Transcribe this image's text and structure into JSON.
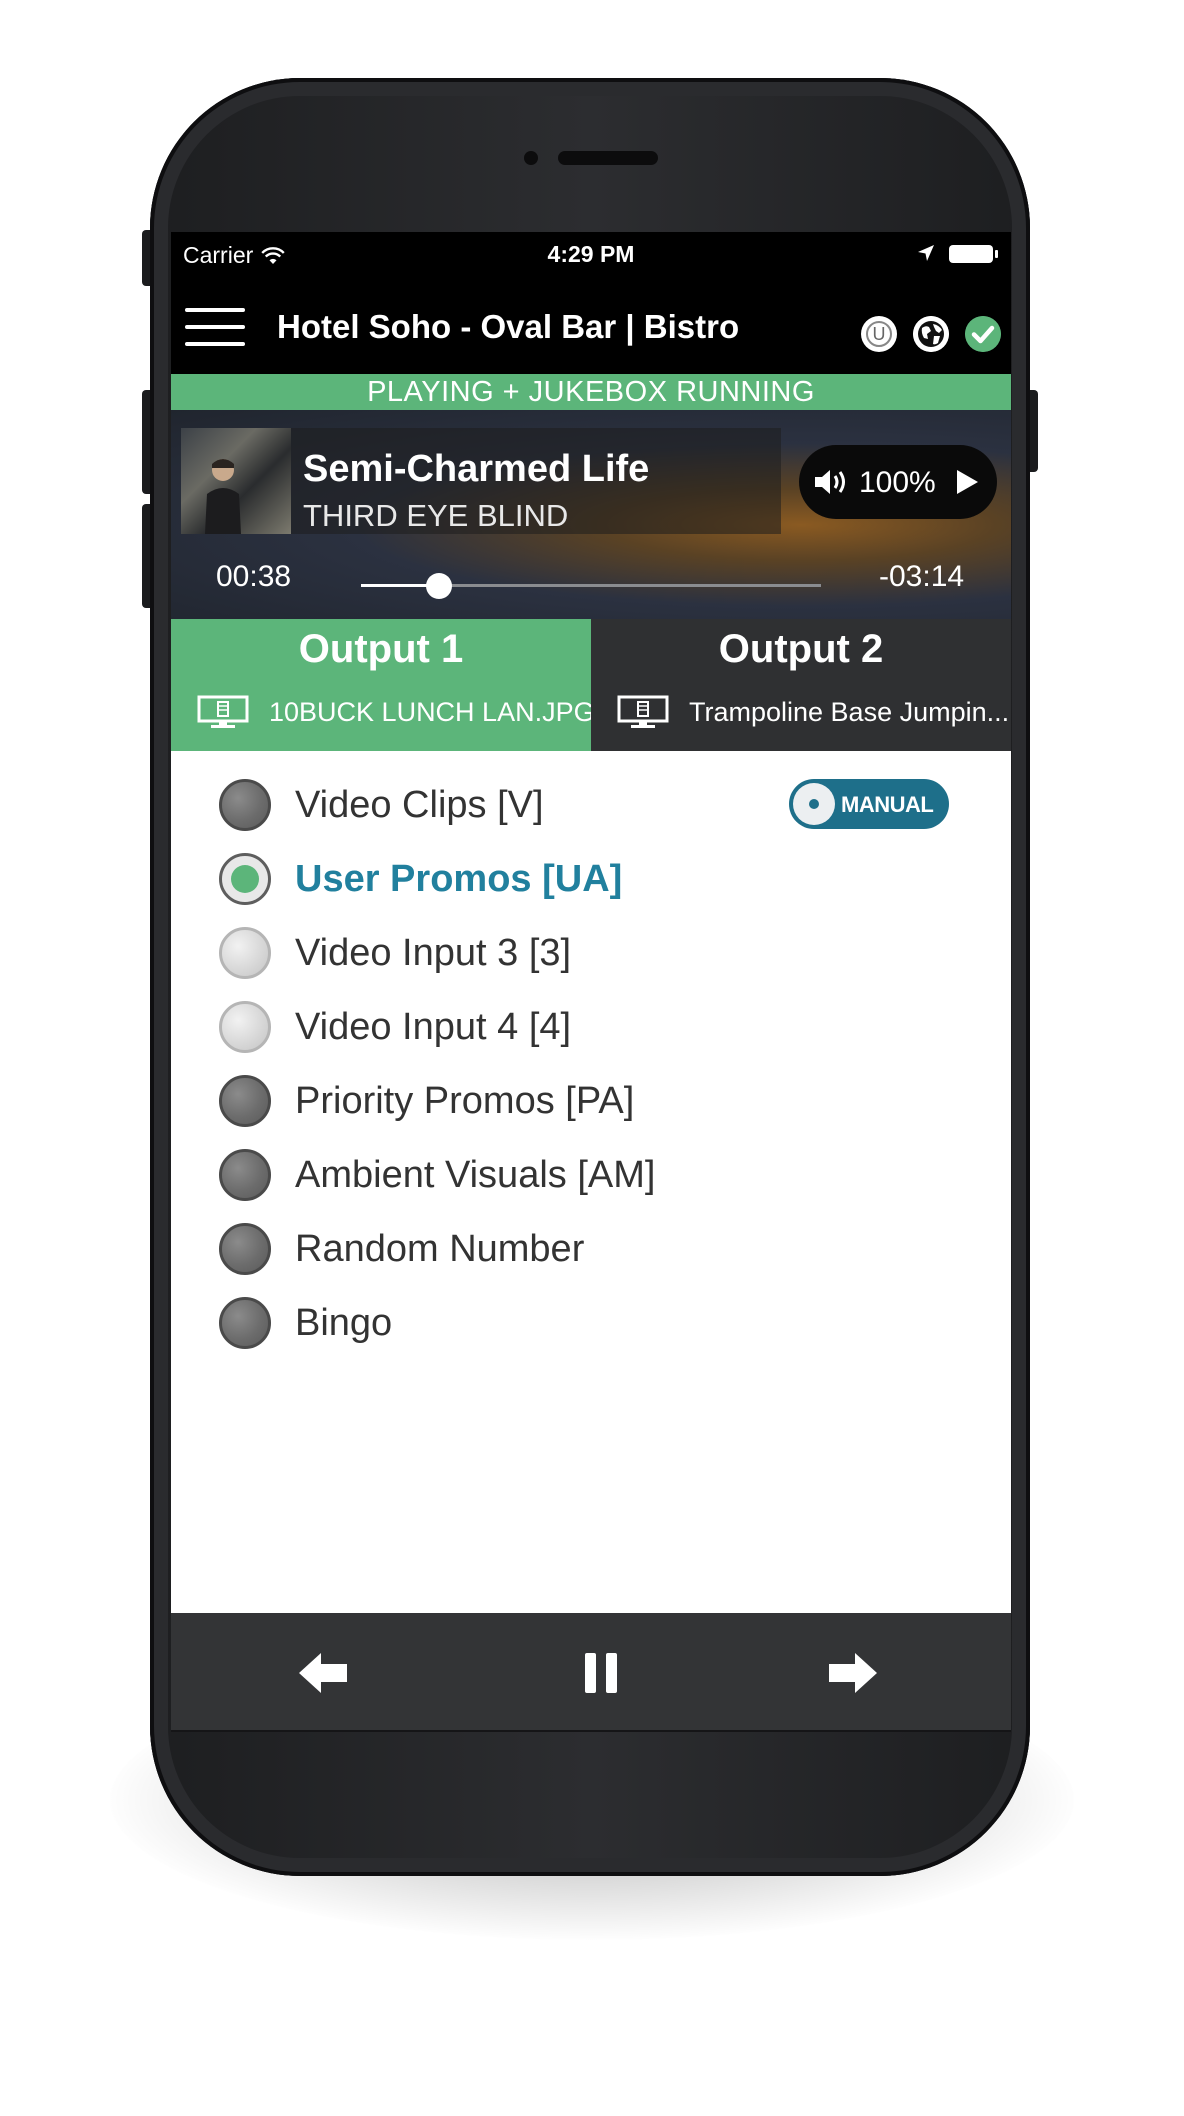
{
  "status_bar": {
    "carrier": "Carrier",
    "time": "4:29 PM"
  },
  "header": {
    "title": "Hotel Soho - Oval Bar | Bistro",
    "user_badge": "U"
  },
  "banner": {
    "text": "PLAYING + JUKEBOX RUNNING"
  },
  "now_playing": {
    "title": "Semi-Charmed Life",
    "artist": "THIRD EYE BLIND",
    "volume": "100%",
    "elapsed": "00:38",
    "remaining": "-03:14",
    "progress": 0.17
  },
  "outputs": [
    {
      "name": "Output 1",
      "content": "10BUCK LUNCH LAN.JPG",
      "active": true
    },
    {
      "name": "Output 2",
      "content": "Trampoline Base Jumpin...",
      "active": false
    }
  ],
  "mode_toggle": {
    "label": "MANUAL"
  },
  "options": [
    {
      "label": "Video Clips [V]",
      "state": "dark"
    },
    {
      "label": "User Promos [UA]",
      "state": "selected"
    },
    {
      "label": "Video Input 3 [3]",
      "state": "light"
    },
    {
      "label": "Video Input 4 [4]",
      "state": "light"
    },
    {
      "label": "Priority Promos [PA]",
      "state": "dark"
    },
    {
      "label": "Ambient Visuals [AM]",
      "state": "dark"
    },
    {
      "label": "Random Number",
      "state": "dark"
    },
    {
      "label": "Bingo",
      "state": "dark"
    }
  ],
  "colors": {
    "accent_green": "#5cb57a",
    "accent_blue": "#21809e",
    "toggle_blue": "#1e6f8a"
  },
  "icons": [
    "hamburger-icon",
    "user-icon",
    "globe-icon",
    "check-icon",
    "volume-icon",
    "play-icon",
    "screen-icon",
    "back-arrow-icon",
    "pause-icon",
    "forward-arrow-icon",
    "wifi-icon",
    "location-icon",
    "battery-icon"
  ]
}
